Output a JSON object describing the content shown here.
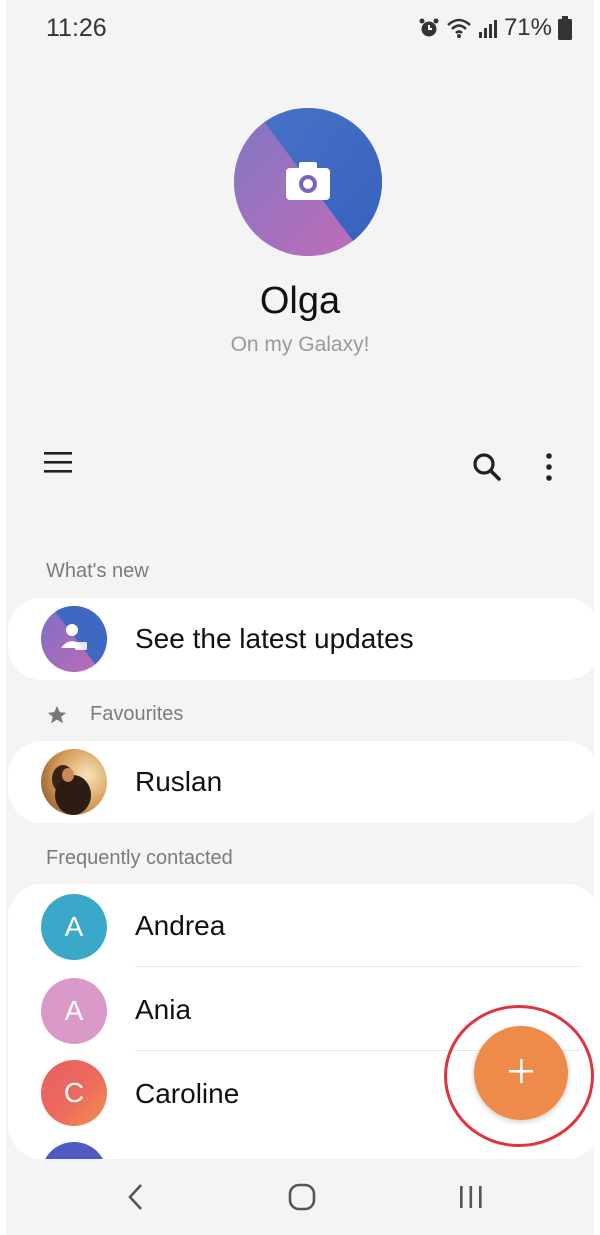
{
  "status_bar": {
    "time": "11:26",
    "battery": "71%",
    "icons": [
      "alarm-icon",
      "wifi-icon",
      "signal-icon",
      "battery-icon"
    ]
  },
  "profile": {
    "name": "Olga",
    "subtitle": "On my Galaxy!",
    "photo_icon": "camera-icon"
  },
  "toolbar": {
    "icons": [
      "menu-icon",
      "search-icon",
      "more-options-icon"
    ]
  },
  "sections": {
    "whats_new": {
      "label": "What's new",
      "item": "See the latest updates"
    },
    "favourites": {
      "label": "Favourites",
      "items": [
        "Ruslan"
      ]
    },
    "frequently_contacted": {
      "label": "Frequently contacted",
      "items": [
        {
          "name": "Andrea",
          "initial": "A",
          "color": "#3aa9c9"
        },
        {
          "name": "Ania",
          "initial": "A",
          "color": "#d99ac9"
        },
        {
          "name": "Caroline",
          "initial": "C",
          "color": "#ec6a5e"
        }
      ]
    }
  },
  "fab": {
    "symbol": "+",
    "color": "#ee8a4a",
    "highlight_color": "#e2333b"
  },
  "nav_bar": {
    "icons": [
      "back-icon",
      "home-icon",
      "recents-icon"
    ]
  }
}
